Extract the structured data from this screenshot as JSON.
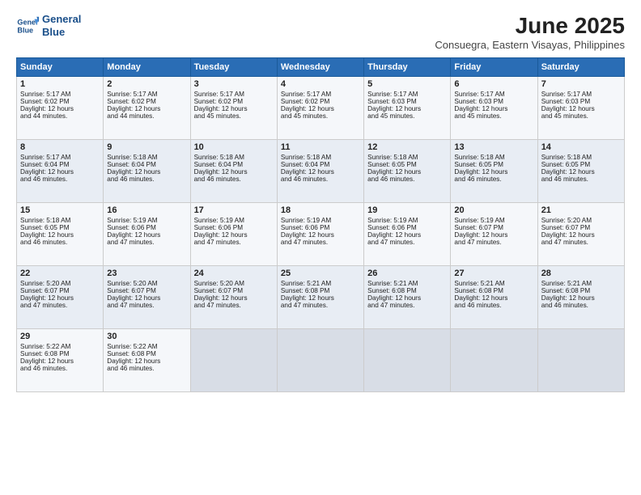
{
  "logo": {
    "line1": "General",
    "line2": "Blue"
  },
  "title": "June 2025",
  "subtitle": "Consuegra, Eastern Visayas, Philippines",
  "weekdays": [
    "Sunday",
    "Monday",
    "Tuesday",
    "Wednesday",
    "Thursday",
    "Friday",
    "Saturday"
  ],
  "weeks": [
    [
      {
        "day": 1,
        "lines": [
          "Sunrise: 5:17 AM",
          "Sunset: 6:02 PM",
          "Daylight: 12 hours",
          "and 44 minutes."
        ]
      },
      {
        "day": 2,
        "lines": [
          "Sunrise: 5:17 AM",
          "Sunset: 6:02 PM",
          "Daylight: 12 hours",
          "and 44 minutes."
        ]
      },
      {
        "day": 3,
        "lines": [
          "Sunrise: 5:17 AM",
          "Sunset: 6:02 PM",
          "Daylight: 12 hours",
          "and 45 minutes."
        ]
      },
      {
        "day": 4,
        "lines": [
          "Sunrise: 5:17 AM",
          "Sunset: 6:02 PM",
          "Daylight: 12 hours",
          "and 45 minutes."
        ]
      },
      {
        "day": 5,
        "lines": [
          "Sunrise: 5:17 AM",
          "Sunset: 6:03 PM",
          "Daylight: 12 hours",
          "and 45 minutes."
        ]
      },
      {
        "day": 6,
        "lines": [
          "Sunrise: 5:17 AM",
          "Sunset: 6:03 PM",
          "Daylight: 12 hours",
          "and 45 minutes."
        ]
      },
      {
        "day": 7,
        "lines": [
          "Sunrise: 5:17 AM",
          "Sunset: 6:03 PM",
          "Daylight: 12 hours",
          "and 45 minutes."
        ]
      }
    ],
    [
      {
        "day": 8,
        "lines": [
          "Sunrise: 5:17 AM",
          "Sunset: 6:04 PM",
          "Daylight: 12 hours",
          "and 46 minutes."
        ]
      },
      {
        "day": 9,
        "lines": [
          "Sunrise: 5:18 AM",
          "Sunset: 6:04 PM",
          "Daylight: 12 hours",
          "and 46 minutes."
        ]
      },
      {
        "day": 10,
        "lines": [
          "Sunrise: 5:18 AM",
          "Sunset: 6:04 PM",
          "Daylight: 12 hours",
          "and 46 minutes."
        ]
      },
      {
        "day": 11,
        "lines": [
          "Sunrise: 5:18 AM",
          "Sunset: 6:04 PM",
          "Daylight: 12 hours",
          "and 46 minutes."
        ]
      },
      {
        "day": 12,
        "lines": [
          "Sunrise: 5:18 AM",
          "Sunset: 6:05 PM",
          "Daylight: 12 hours",
          "and 46 minutes."
        ]
      },
      {
        "day": 13,
        "lines": [
          "Sunrise: 5:18 AM",
          "Sunset: 6:05 PM",
          "Daylight: 12 hours",
          "and 46 minutes."
        ]
      },
      {
        "day": 14,
        "lines": [
          "Sunrise: 5:18 AM",
          "Sunset: 6:05 PM",
          "Daylight: 12 hours",
          "and 46 minutes."
        ]
      }
    ],
    [
      {
        "day": 15,
        "lines": [
          "Sunrise: 5:18 AM",
          "Sunset: 6:05 PM",
          "Daylight: 12 hours",
          "and 46 minutes."
        ]
      },
      {
        "day": 16,
        "lines": [
          "Sunrise: 5:19 AM",
          "Sunset: 6:06 PM",
          "Daylight: 12 hours",
          "and 47 minutes."
        ]
      },
      {
        "day": 17,
        "lines": [
          "Sunrise: 5:19 AM",
          "Sunset: 6:06 PM",
          "Daylight: 12 hours",
          "and 47 minutes."
        ]
      },
      {
        "day": 18,
        "lines": [
          "Sunrise: 5:19 AM",
          "Sunset: 6:06 PM",
          "Daylight: 12 hours",
          "and 47 minutes."
        ]
      },
      {
        "day": 19,
        "lines": [
          "Sunrise: 5:19 AM",
          "Sunset: 6:06 PM",
          "Daylight: 12 hours",
          "and 47 minutes."
        ]
      },
      {
        "day": 20,
        "lines": [
          "Sunrise: 5:19 AM",
          "Sunset: 6:07 PM",
          "Daylight: 12 hours",
          "and 47 minutes."
        ]
      },
      {
        "day": 21,
        "lines": [
          "Sunrise: 5:20 AM",
          "Sunset: 6:07 PM",
          "Daylight: 12 hours",
          "and 47 minutes."
        ]
      }
    ],
    [
      {
        "day": 22,
        "lines": [
          "Sunrise: 5:20 AM",
          "Sunset: 6:07 PM",
          "Daylight: 12 hours",
          "and 47 minutes."
        ]
      },
      {
        "day": 23,
        "lines": [
          "Sunrise: 5:20 AM",
          "Sunset: 6:07 PM",
          "Daylight: 12 hours",
          "and 47 minutes."
        ]
      },
      {
        "day": 24,
        "lines": [
          "Sunrise: 5:20 AM",
          "Sunset: 6:07 PM",
          "Daylight: 12 hours",
          "and 47 minutes."
        ]
      },
      {
        "day": 25,
        "lines": [
          "Sunrise: 5:21 AM",
          "Sunset: 6:08 PM",
          "Daylight: 12 hours",
          "and 47 minutes."
        ]
      },
      {
        "day": 26,
        "lines": [
          "Sunrise: 5:21 AM",
          "Sunset: 6:08 PM",
          "Daylight: 12 hours",
          "and 47 minutes."
        ]
      },
      {
        "day": 27,
        "lines": [
          "Sunrise: 5:21 AM",
          "Sunset: 6:08 PM",
          "Daylight: 12 hours",
          "and 46 minutes."
        ]
      },
      {
        "day": 28,
        "lines": [
          "Sunrise: 5:21 AM",
          "Sunset: 6:08 PM",
          "Daylight: 12 hours",
          "and 46 minutes."
        ]
      }
    ],
    [
      {
        "day": 29,
        "lines": [
          "Sunrise: 5:22 AM",
          "Sunset: 6:08 PM",
          "Daylight: 12 hours",
          "and 46 minutes."
        ]
      },
      {
        "day": 30,
        "lines": [
          "Sunrise: 5:22 AM",
          "Sunset: 6:08 PM",
          "Daylight: 12 hours",
          "and 46 minutes."
        ]
      },
      {
        "day": null,
        "lines": []
      },
      {
        "day": null,
        "lines": []
      },
      {
        "day": null,
        "lines": []
      },
      {
        "day": null,
        "lines": []
      },
      {
        "day": null,
        "lines": []
      }
    ]
  ]
}
